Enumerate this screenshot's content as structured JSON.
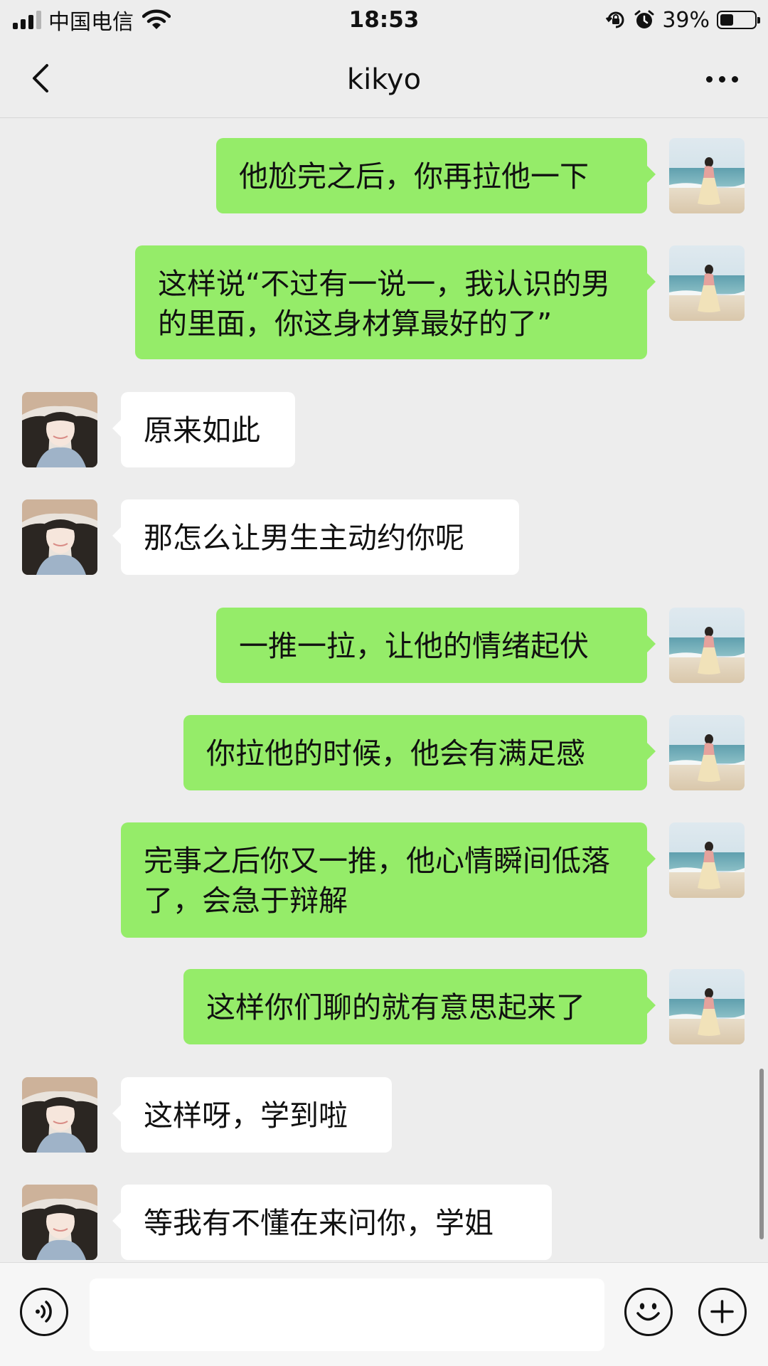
{
  "status_bar": {
    "carrier": "中国电信",
    "time": "18:53",
    "battery_percent": "39%",
    "battery_level": 0.39,
    "icons": [
      "signal-icon",
      "wifi-icon",
      "rotation-lock-icon",
      "alarm-icon",
      "battery-icon"
    ]
  },
  "nav": {
    "title": "kikyo",
    "back_icon": "chevron-left-icon",
    "more_icon": "more-icon"
  },
  "messages": [
    {
      "side": "out",
      "text": "他尬完之后，你再拉他一下"
    },
    {
      "side": "out",
      "text": "这样说“不过有一说一，我认识的男的里面，你这身材算最好的了”"
    },
    {
      "side": "in",
      "text": "原来如此"
    },
    {
      "side": "in",
      "text": "那怎么让男生主动约你呢"
    },
    {
      "side": "out",
      "text": "一推一拉，让他的情绪起伏"
    },
    {
      "side": "out",
      "text": "你拉他的时候，他会有满足感"
    },
    {
      "side": "out",
      "text": "完事之后你又一推，他心情瞬间低落了，会急于辩解"
    },
    {
      "side": "out",
      "text": "这样你们聊的就有意思起来了"
    },
    {
      "side": "in",
      "text": "这样呀，学到啦"
    },
    {
      "side": "in",
      "text": "等我有不懂在来问你，学姐"
    }
  ],
  "input_bar": {
    "value": "",
    "voice_icon": "voice-icon",
    "emoji_icon": "emoji-icon",
    "plus_icon": "plus-icon"
  },
  "colors": {
    "background": "#ededed",
    "outgoing_bubble": "#95ec69",
    "incoming_bubble": "#ffffff"
  }
}
